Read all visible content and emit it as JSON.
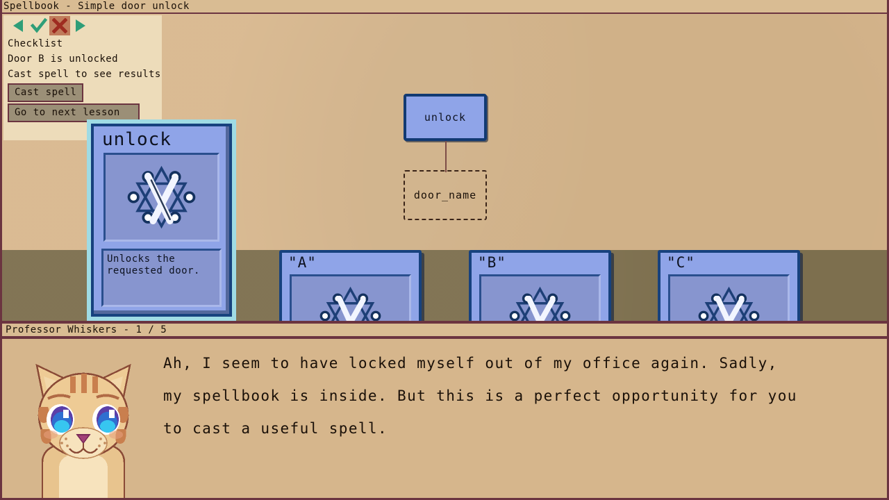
{
  "window": {
    "title": "Spellbook - Simple door unlock"
  },
  "checklist": {
    "toolbar": [
      {
        "name": "prev-icon",
        "glyph": "◀",
        "active": false
      },
      {
        "name": "check-icon",
        "glyph": "✓",
        "active": false
      },
      {
        "name": "close-icon",
        "glyph": "✕",
        "active": true
      },
      {
        "name": "next-icon",
        "glyph": "▶",
        "active": false
      }
    ],
    "heading": "Checklist",
    "items": [
      "Door B is unlocked"
    ],
    "hint": "Cast spell to see results.",
    "cast_button": "Cast spell",
    "next_button": "Go to next lesson"
  },
  "graph": {
    "node": {
      "label": "unlock"
    },
    "slot": {
      "label": "door_name"
    }
  },
  "selected_card": {
    "title": "unlock",
    "description": "Unlocks the\nrequested door.",
    "art": "lambda-hexagram-icon"
  },
  "shelf_cards": [
    {
      "title": "\"A\"",
      "art": "lambda-hexagram-icon"
    },
    {
      "title": "\"B\"",
      "art": "lambda-hexagram-icon"
    },
    {
      "title": "\"C\"",
      "art": "lambda-hexagram-icon"
    }
  ],
  "dialogue": {
    "speaker": "Professor Whiskers",
    "page": "1 / 5",
    "nameplate": "Professor Whiskers - 1 / 5",
    "text": "Ah, I seem to have locked myself out of my office again. Sadly,\nmy spellbook is inside. But this is a perfect opportunity for you\nto cast a useful spell.",
    "portrait": "professor-whiskers-cat-portrait"
  },
  "colors": {
    "frame": "#6b3440",
    "titlebar": "#d9bc93",
    "wall": "#d8b78d",
    "shelf": "#7d6f4e",
    "panel": "#eddcba",
    "card_fill": "#8fa4e8",
    "card_border": "#17427e",
    "card_highlight": "#9fdbe4",
    "button_fill": "#9b8f77",
    "accent_red": "#c0392b",
    "accent_green": "#2e9e78"
  }
}
